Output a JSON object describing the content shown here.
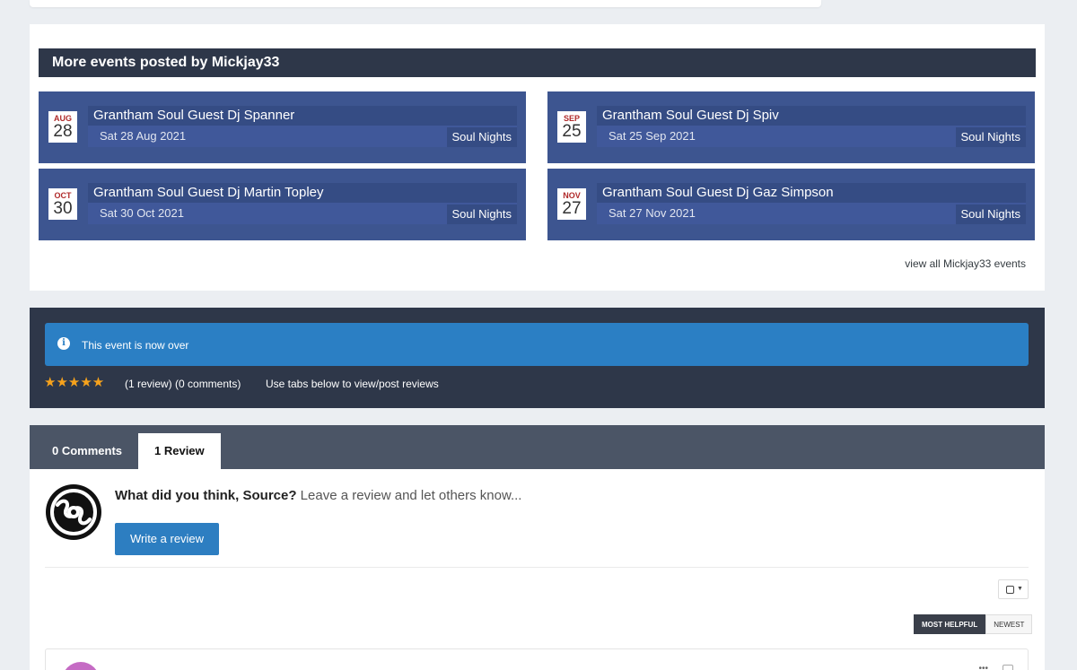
{
  "more_events": {
    "heading": "More events posted by Mickjay33",
    "events": [
      {
        "month": "AUG",
        "day": "28",
        "title": "Grantham Soul Guest Dj Spanner",
        "date": "Sat 28 Aug 2021",
        "category": "Soul Nights"
      },
      {
        "month": "SEP",
        "day": "25",
        "title": "Grantham Soul Guest Dj Spiv",
        "date": "Sat 25 Sep 2021",
        "category": "Soul Nights"
      },
      {
        "month": "OCT",
        "day": "30",
        "title": "Grantham Soul Guest Dj Martin Topley",
        "date": "Sat 30 Oct 2021",
        "category": "Soul Nights"
      },
      {
        "month": "NOV",
        "day": "27",
        "title": "Grantham Soul Guest Dj Gaz Simpson",
        "date": "Sat 27 Nov 2021",
        "category": "Soul Nights"
      }
    ],
    "view_all": "view all Mickjay33 events"
  },
  "status": {
    "message": "This event is now over",
    "stars": "★★★★★",
    "rating_value": 5,
    "rating_text": "(1 review) (0 comments)",
    "hint": "Use tabs below to view/post reviews"
  },
  "reviews": {
    "tabs": [
      "0 Comments",
      "1 Review"
    ],
    "active_tab": "1 Review",
    "prompt_bold": "What did you think, Source?",
    "prompt_rest": " Leave a review and let others know...",
    "write_button": "Write a review",
    "sort": [
      "MOST HELPFUL",
      "NEWEST"
    ],
    "active_sort": "MOST HELPFUL"
  },
  "colors": {
    "event_card": "#3d5590",
    "header_dark": "#2e3749",
    "info_blue": "#2b7fc4",
    "star": "#f6a21c",
    "button_blue": "#2d7ec1"
  }
}
